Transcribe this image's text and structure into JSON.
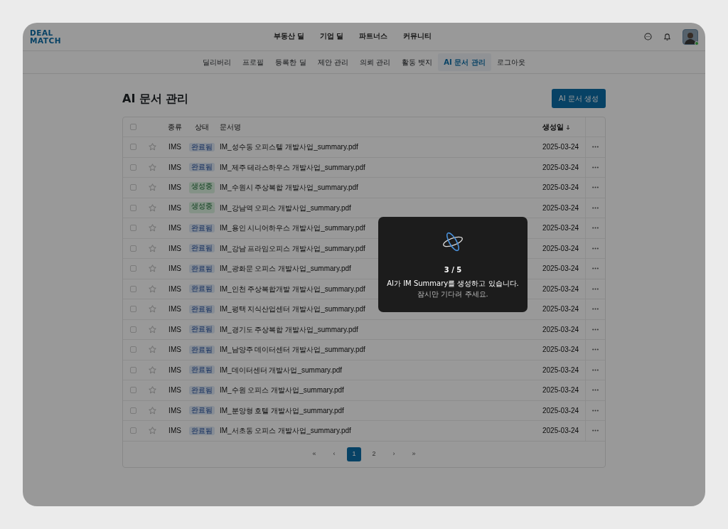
{
  "header": {
    "logo_lines": [
      "DEAL",
      "MATCH"
    ],
    "main_nav": [
      "부동산 딜",
      "기업 딜",
      "파트너스",
      "커뮤니티"
    ],
    "user": {
      "online": true
    }
  },
  "sub_nav": [
    {
      "label": "딜리버리",
      "selected": false
    },
    {
      "label": "프로필",
      "selected": false
    },
    {
      "label": "등록한 딜",
      "selected": false
    },
    {
      "label": "제안 관리",
      "selected": false
    },
    {
      "label": "의뢰 관리",
      "selected": false
    },
    {
      "label": "활동 뱃지",
      "selected": false
    },
    {
      "label": "AI 문서 관리",
      "selected": true
    },
    {
      "label": "로그아웃",
      "selected": false
    }
  ],
  "page_title": "AI 문서 관리",
  "create_button": "AI 문서 생성",
  "table": {
    "all_checked": false,
    "columns": [
      {
        "label": "종류",
        "sorted": false
      },
      {
        "label": "상태",
        "sorted": false
      },
      {
        "label": "문서명",
        "sorted": false
      },
      {
        "label": "생성일",
        "sorted": true
      }
    ],
    "rows": [
      {
        "checked": false,
        "starred": false,
        "type": "IMS",
        "status": {
          "label": "완료됨",
          "kind": "done"
        },
        "name": "IM_성수동 오피스텔 개발사업_summary.pdf",
        "date": "2025-03-24"
      },
      {
        "checked": false,
        "starred": false,
        "type": "IMS",
        "status": {
          "label": "완료됨",
          "kind": "done"
        },
        "name": "IM_제주 테라스하우스 개발사업_summary.pdf",
        "date": "2025-03-24"
      },
      {
        "checked": false,
        "starred": false,
        "type": "IMS",
        "status": {
          "label": "생성중",
          "kind": "progress"
        },
        "name": "IM_수원시 주상복합 개발사업_summary.pdf",
        "date": "2025-03-24"
      },
      {
        "checked": false,
        "starred": false,
        "type": "IMS",
        "status": {
          "label": "생성중",
          "kind": "progress"
        },
        "name": "IM_강남역 오피스 개발사업_summary.pdf",
        "date": "2025-03-24"
      },
      {
        "checked": false,
        "starred": false,
        "type": "IMS",
        "status": {
          "label": "완료됨",
          "kind": "done"
        },
        "name": "IM_용인 시니어하우스 개발사업_summary.pdf",
        "date": "2025-03-24"
      },
      {
        "checked": false,
        "starred": false,
        "type": "IMS",
        "status": {
          "label": "완료됨",
          "kind": "done"
        },
        "name": "IM_강남 프라임오피스 개발사업_summary.pdf",
        "date": "2025-03-24"
      },
      {
        "checked": false,
        "starred": false,
        "type": "IMS",
        "status": {
          "label": "완료됨",
          "kind": "done"
        },
        "name": "IM_광화문 오피스 개발사업_summary.pdf",
        "date": "2025-03-24"
      },
      {
        "checked": false,
        "starred": false,
        "type": "IMS",
        "status": {
          "label": "완료됨",
          "kind": "done"
        },
        "name": "IM_인천 주상복합개발 개발사업_summary.pdf",
        "date": "2025-03-24"
      },
      {
        "checked": false,
        "starred": false,
        "type": "IMS",
        "status": {
          "label": "완료됨",
          "kind": "done"
        },
        "name": "IM_평택 지식산업센터 개발사업_summary.pdf",
        "date": "2025-03-24"
      },
      {
        "checked": false,
        "starred": false,
        "type": "IMS",
        "status": {
          "label": "완료됨",
          "kind": "done"
        },
        "name": "IM_경기도 주상복합 개발사업_summary.pdf",
        "date": "2025-03-24"
      },
      {
        "checked": false,
        "starred": false,
        "type": "IMS",
        "status": {
          "label": "완료됨",
          "kind": "done"
        },
        "name": "IM_남양주 데이터센터 개발사업_summary.pdf",
        "date": "2025-03-24"
      },
      {
        "checked": false,
        "starred": false,
        "type": "IMS",
        "status": {
          "label": "완료됨",
          "kind": "done"
        },
        "name": "IM_데이터센터 개발사업_summary.pdf",
        "date": "2025-03-24"
      },
      {
        "checked": false,
        "starred": false,
        "type": "IMS",
        "status": {
          "label": "완료됨",
          "kind": "done"
        },
        "name": "IM_수원 오피스 개발사업_summary.pdf",
        "date": "2025-03-24"
      },
      {
        "checked": false,
        "starred": false,
        "type": "IMS",
        "status": {
          "label": "완료됨",
          "kind": "done"
        },
        "name": "IM_분양형 호텔 개발사업_summary.pdf",
        "date": "2025-03-24"
      },
      {
        "checked": false,
        "starred": false,
        "type": "IMS",
        "status": {
          "label": "완료됨",
          "kind": "done"
        },
        "name": "IM_서초동 오피스 개발사업_summary.pdf",
        "date": "2025-03-24"
      }
    ]
  },
  "pagination": {
    "first": "«",
    "prev": "‹",
    "pages": [
      {
        "label": "1",
        "selected": true
      },
      {
        "label": "2",
        "selected": false
      }
    ],
    "next": "›",
    "last": "»"
  },
  "modal": {
    "progress": "3 / 5",
    "message": "AI가 IM Summary를 생성하고 있습니다.",
    "hint": "잠시만 기다려 주세요."
  }
}
